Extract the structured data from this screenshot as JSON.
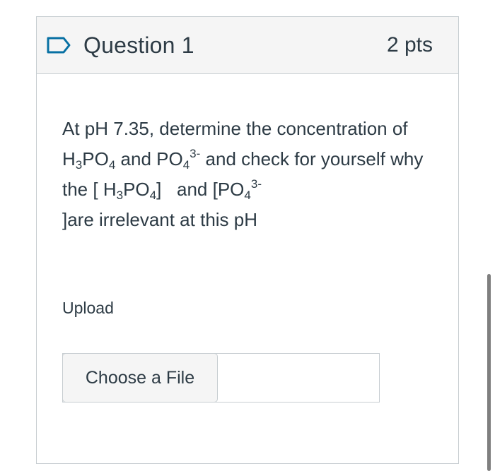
{
  "question": {
    "title": "Question 1",
    "points": "2 pts",
    "text_parts": {
      "intro": "At pH 7.35, determine the concentration of H",
      "h3po4_sub1": "3",
      "po": "PO",
      "h3po4_sub2": "4",
      "and1": " and PO",
      "po4_sub1": "4",
      "po4_sup1": "3-",
      "mid": " and check for yourself why the [ H",
      "h3po4_sub3": "3",
      "po2": "PO",
      "h3po4_sub4": "4",
      "bracket_and": "]   and [PO",
      "po4_sub2": "4",
      "po4_sup2": "3-",
      "tail": " ]are irrelevant at this pH"
    },
    "upload_label": "Upload",
    "choose_file_label": "Choose a File"
  },
  "icons": {
    "flag": "bookmark-flag-icon"
  },
  "colors": {
    "text": "#2d3b45",
    "header_bg": "#f5f5f5",
    "border": "#c7cdd1",
    "flag_stroke": "#0770a3"
  }
}
